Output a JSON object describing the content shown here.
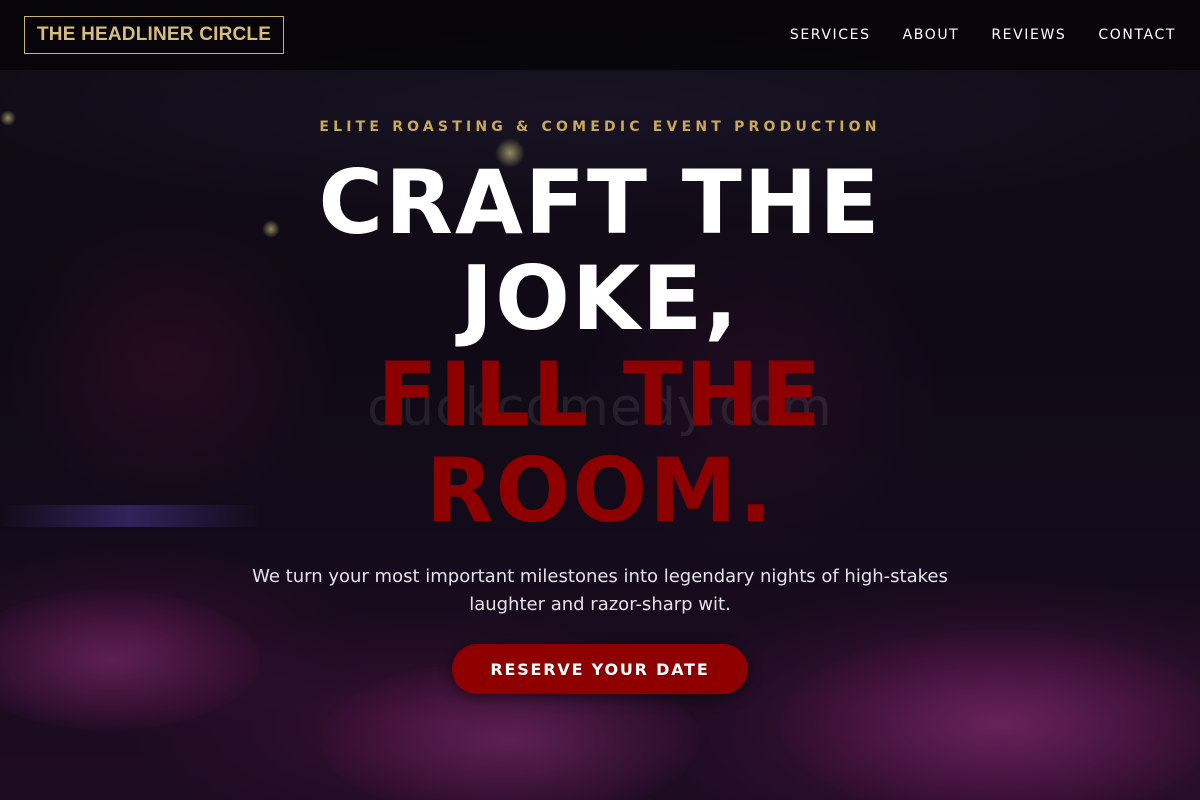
{
  "header": {
    "logo_text": "THE HEADLINER CIRCLE",
    "nav": [
      {
        "label": "SERVICES"
      },
      {
        "label": "ABOUT"
      },
      {
        "label": "REVIEWS"
      },
      {
        "label": "CONTACT"
      }
    ]
  },
  "hero": {
    "eyebrow": "ELITE ROASTING & COMEDIC EVENT PRODUCTION",
    "headline_white": "CRAFT THE JOKE,",
    "headline_red": "FILL THE ROOM.",
    "subtitle": "We turn your most important milestones into legendary nights of high-stakes laughter and razor-sharp wit.",
    "cta_label": "RESERVE YOUR DATE",
    "background_watermark": "duckcomedy.com"
  },
  "colors": {
    "accent_gold": "#c9a85c",
    "accent_red": "#8e0000",
    "header_bg": "#060508"
  }
}
